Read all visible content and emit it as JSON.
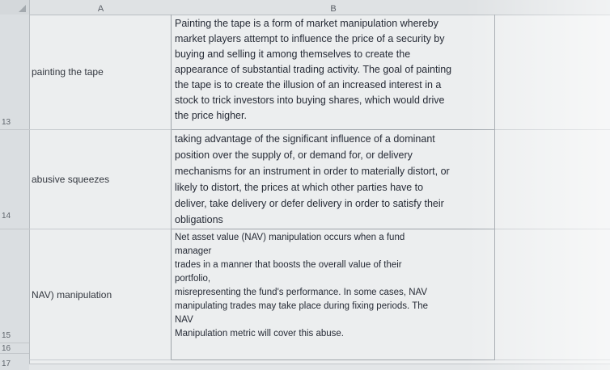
{
  "columns": {
    "a": "A",
    "b": "B"
  },
  "rows": [
    {
      "number": "13",
      "term": "painting the tape",
      "lines": [
        "Painting the tape is a form of market manipulation whereby",
        "market players attempt to influence the price of a security by",
        "buying and selling it among themselves to create the",
        "appearance of substantial trading activity. The goal of painting",
        "the tape is to create the illusion of an increased interest in a",
        "stock to trick investors into buying shares, which would drive",
        "the price higher."
      ]
    },
    {
      "number": "14",
      "term": "abusive squeezes",
      "lines": [
        "taking advantage of the significant influence of a dominant",
        "position over the supply of, or demand for, or delivery",
        "mechanisms for an instrument in order to materially distort, or",
        "likely to distort, the prices at which other parties have to",
        "deliver, take delivery or defer delivery in order to satisfy their",
        "obligations"
      ]
    },
    {
      "number": "15",
      "term": "NAV) manipulation",
      "lines": [
        "Net asset value (NAV) manipulation occurs when a fund",
        "manager",
        "trades in a manner that boosts the overall value of their",
        "portfolio,",
        "misrepresenting the fund's performance. In some cases, NAV",
        "manipulating trades may take place during fixing periods. The",
        "NAV",
        "Manipulation metric will cover this abuse."
      ]
    },
    {
      "number": "16"
    },
    {
      "number": "17"
    }
  ]
}
